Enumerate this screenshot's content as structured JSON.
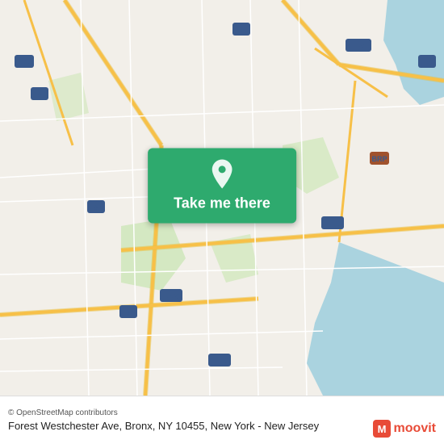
{
  "map": {
    "alt": "Map of Forest Westchester Ave, Bronx, NY area"
  },
  "button": {
    "label": "Take me there"
  },
  "footer": {
    "attribution": "© OpenStreetMap contributors",
    "address": "Forest Westchester Ave, Bronx, NY 10455, New York - New Jersey"
  },
  "brand": {
    "name": "moovit"
  }
}
